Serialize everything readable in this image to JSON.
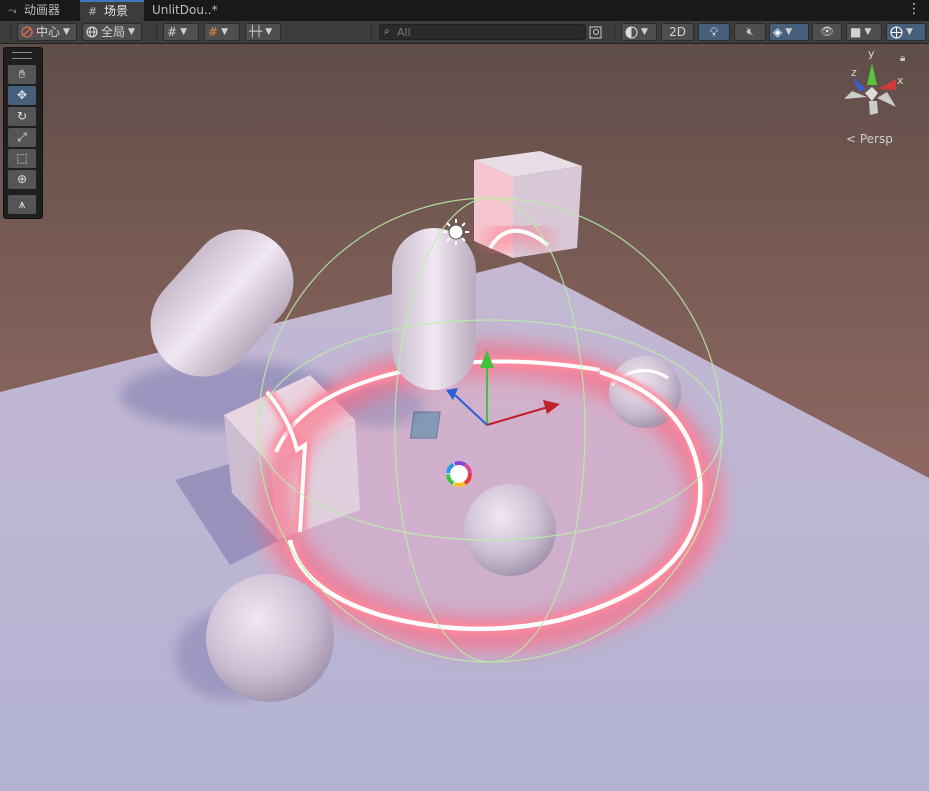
{
  "tabs": [
    {
      "icon": "animator-icon",
      "label": "动画器"
    },
    {
      "icon": "scene-grid-icon",
      "label": "场景"
    },
    {
      "icon": "",
      "label": "UnlitDou..*"
    }
  ],
  "toolbar": {
    "pivot_label": "中心",
    "space_label": "全局",
    "search_placeholder": "All",
    "mode_2d_label": "2D"
  },
  "scene": {
    "projection_label": "< Persp",
    "gizmo_axes": {
      "x": "x",
      "y": "y",
      "z": "z"
    }
  },
  "colors": {
    "accent": "#3a79bb",
    "active_button": "#46607c",
    "glow_ring": "#ff6b7d",
    "handle_x": "#c0202a",
    "handle_y": "#42c23a",
    "handle_z": "#2a5fd8",
    "light_gizmo_sphere": "#b9f0a6"
  },
  "tools": [
    "hand-tool",
    "move-tool",
    "rotate-tool",
    "scale-tool",
    "rect-tool",
    "transform-tool",
    "custom-tool"
  ]
}
